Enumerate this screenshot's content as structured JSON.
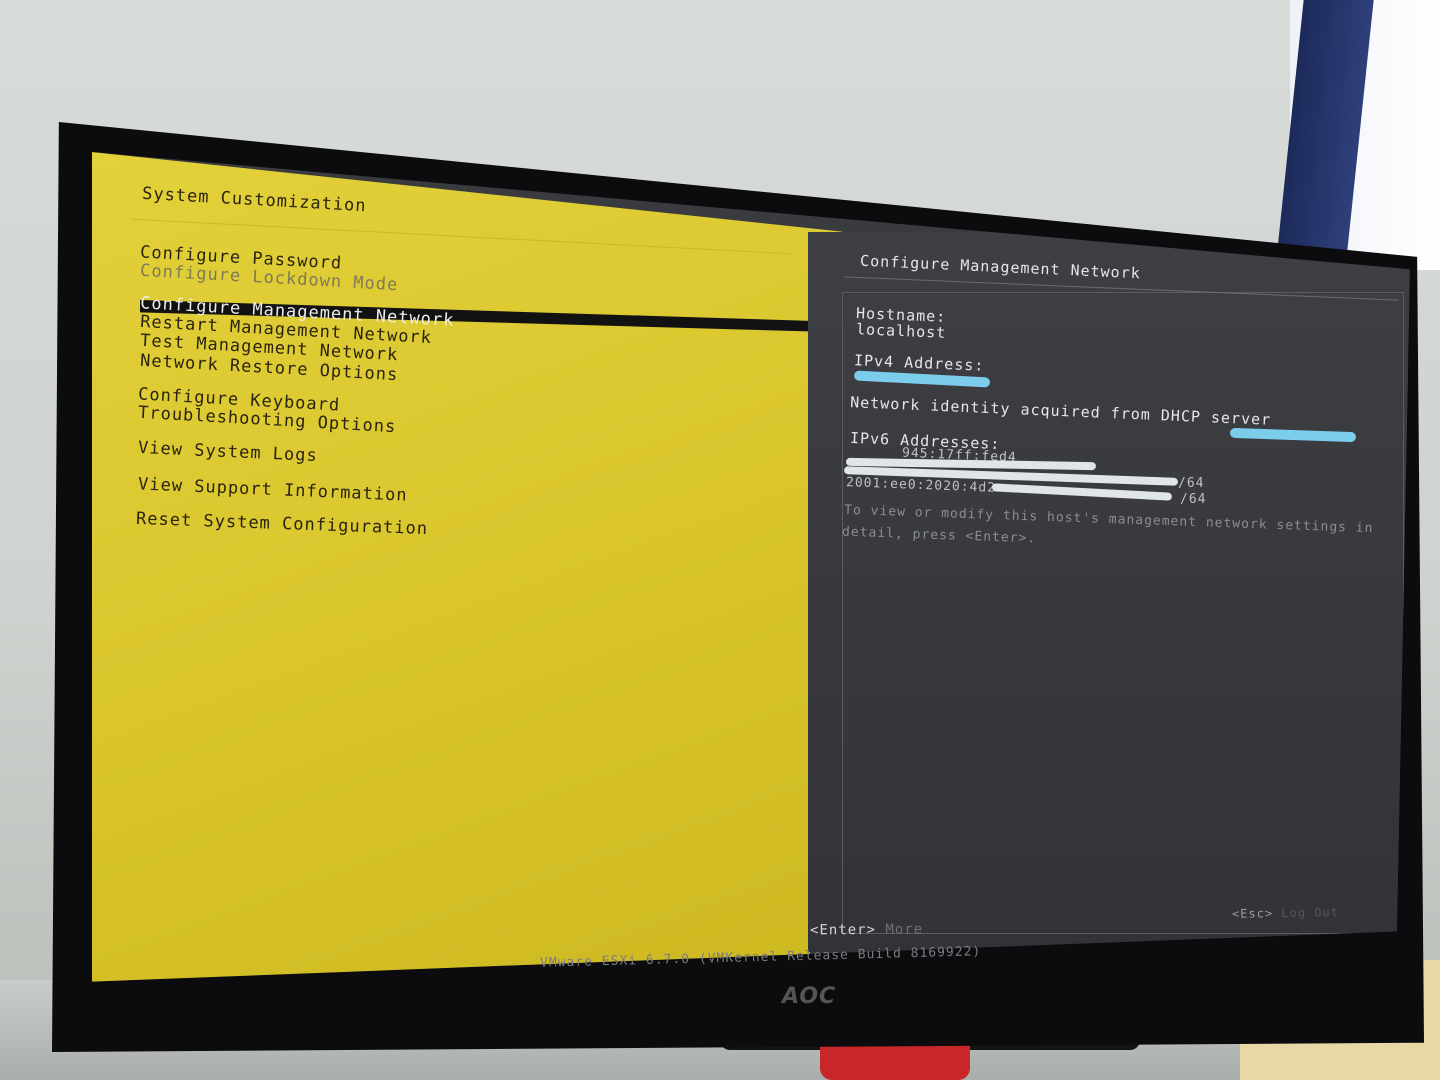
{
  "left_pane": {
    "title": "System Customization",
    "items": [
      "Configure Password",
      "Configure Lockdown Mode",
      "Configure Management Network",
      "Restart Management Network",
      "Test Management Network",
      "Network Restore Options",
      "Configure Keyboard",
      "Troubleshooting Options",
      "View System Logs",
      "View Support Information",
      "Reset System Configuration"
    ],
    "selected_item": "Configure Management Network"
  },
  "right_pane": {
    "title": "Configure Management Network",
    "hostname_label": "Hostname:",
    "hostname_value": "localhost",
    "ipv4_label": "IPv4 Address:",
    "dhcp_text": "Network identity acquired from DHCP server",
    "ipv6_label": "IPv6 Addresses:",
    "ipv6_line1": "945:17ff:fed4",
    "ipv6_line2": "/64",
    "ipv6_line3": "2001:ee0:2020:4d2",
    "ipv6_line4": "/64",
    "help_line1": "To view or modify this host's management network settings in",
    "help_line2": "detail, press <Enter>.",
    "enter_key": "<Enter>",
    "enter_action": "More",
    "esc_key": "<Esc>",
    "esc_action": "Log Out"
  },
  "footer": {
    "status": "VMware ESXi 6.7.0 (VMKernel Release Build 8169922)",
    "brand": "AOC"
  },
  "colors": {
    "dcui_yellow": "#d8c32a",
    "dcui_gray": "#3a3b3e",
    "redaction": "#7fd4f4"
  }
}
